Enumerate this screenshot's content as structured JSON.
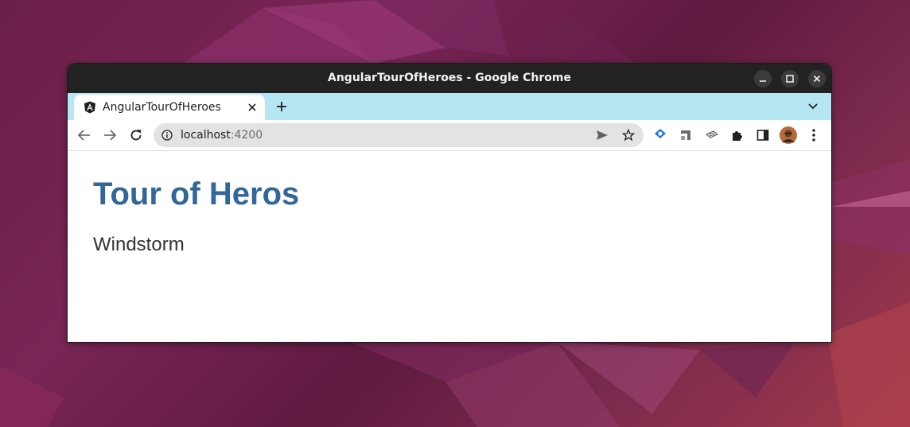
{
  "window": {
    "title": "AngularTourOfHeroes - Google Chrome"
  },
  "tabs": [
    {
      "label": "AngularTourOfHeroes",
      "icon": "angular-icon",
      "active": true
    }
  ],
  "address_bar": {
    "host": "localhost",
    "port": ":4200"
  },
  "page": {
    "title": "Tour of Heros",
    "hero_name": "Windstorm"
  },
  "colors": {
    "title_bar": "#222222",
    "tab_strip": "#b5e6f2",
    "heading": "#336699",
    "body_text": "#333333",
    "desktop_accent": "#7a2557"
  }
}
